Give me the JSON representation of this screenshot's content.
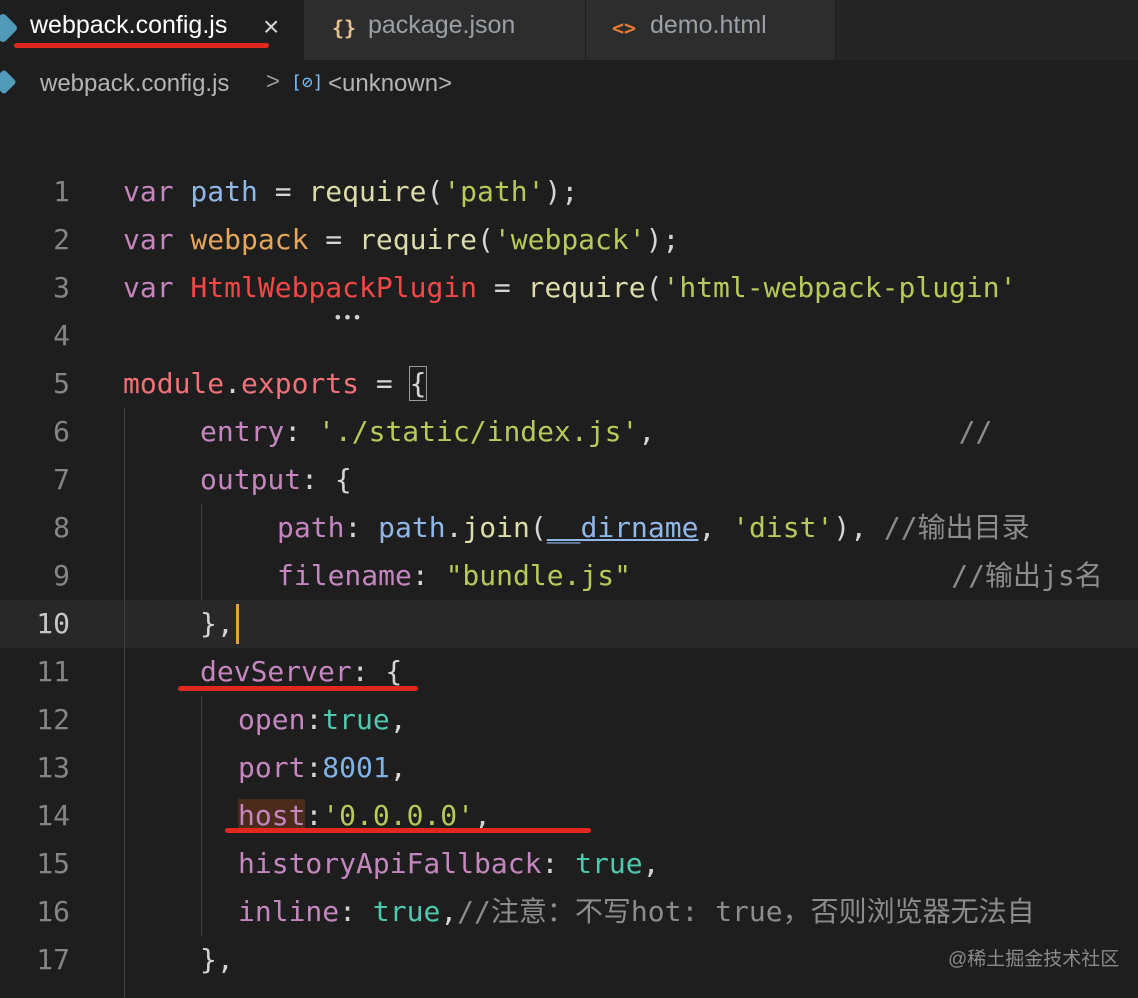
{
  "tabs": [
    {
      "label": "webpack.config.js",
      "close": "×",
      "active": true
    },
    {
      "label": "package.json",
      "icon": "{}"
    },
    {
      "label": "demo.html",
      "icon": "<>"
    }
  ],
  "breadcrumb": {
    "file": "webpack.config.js",
    "separator": ">",
    "symbol_icon": "[⊘]",
    "symbol": "<unknown>"
  },
  "line_numbers": [
    "1",
    "2",
    "3",
    "4",
    "5",
    "6",
    "7",
    "8",
    "9",
    "10",
    "11",
    "12",
    "13",
    "14",
    "15",
    "16",
    "17"
  ],
  "code": {
    "l1": {
      "a": "var",
      "b": " path ",
      "c": "=",
      "d": " ",
      "e": "require",
      "f": "(",
      "g": "'path'",
      "h": ");"
    },
    "l2": {
      "a": "var",
      "b": " webpack ",
      "c": "=",
      "d": " ",
      "e": "require",
      "f": "(",
      "g": "'webpack'",
      "h": ");"
    },
    "l3": {
      "a": "var",
      "b": " HtmlWebpackPlugin ",
      "c": "=",
      "d": " ",
      "e": "require",
      "f": "(",
      "g": "'html-webpack-plugin'"
    },
    "l5": {
      "a": "module",
      "b": ".",
      "c": "exports",
      "d": " = ",
      "e": "{"
    },
    "l6": {
      "a": "entry",
      "b": ": ",
      "c": "'./static/index.js'",
      "d": ",",
      "e": "                  //"
    },
    "l7": {
      "a": "output",
      "b": ": {"
    },
    "l8": {
      "a": "path",
      "b": ": ",
      "c": "path",
      "d": ".",
      "e": "join",
      "f": "(",
      "g": "__dirname",
      "h": ", ",
      "i": "'dist'",
      "j": "), ",
      "k": "//输出目录"
    },
    "l9": {
      "a": "filename",
      "b": ": ",
      "c": "\"bundle.js\"",
      "d": "                   //输出js名"
    },
    "l10": {
      "a": "},"
    },
    "l11": {
      "a": "devServer",
      "b": ": {"
    },
    "l12": {
      "a": "open",
      "b": ":",
      "c": "true",
      "d": ","
    },
    "l13": {
      "a": "port",
      "b": ":",
      "c": "8001",
      "d": ","
    },
    "l14": {
      "a": "host",
      "b": ":",
      "c": "'0.0.0.0'",
      "d": ","
    },
    "l15": {
      "a": "historyApiFallback",
      "b": ": ",
      "c": "true",
      "d": ","
    },
    "l16": {
      "a": "inline",
      "b": ": ",
      "c": "true",
      "d": ",",
      "e": "//注意：不写hot: true，否则浏览器无法自"
    },
    "l17": {
      "a": "},"
    }
  },
  "watermark": "@稀土掘金技术社区",
  "colors": {
    "annotation_red": "#e0281e",
    "editor_bg": "#1e1e1e"
  }
}
